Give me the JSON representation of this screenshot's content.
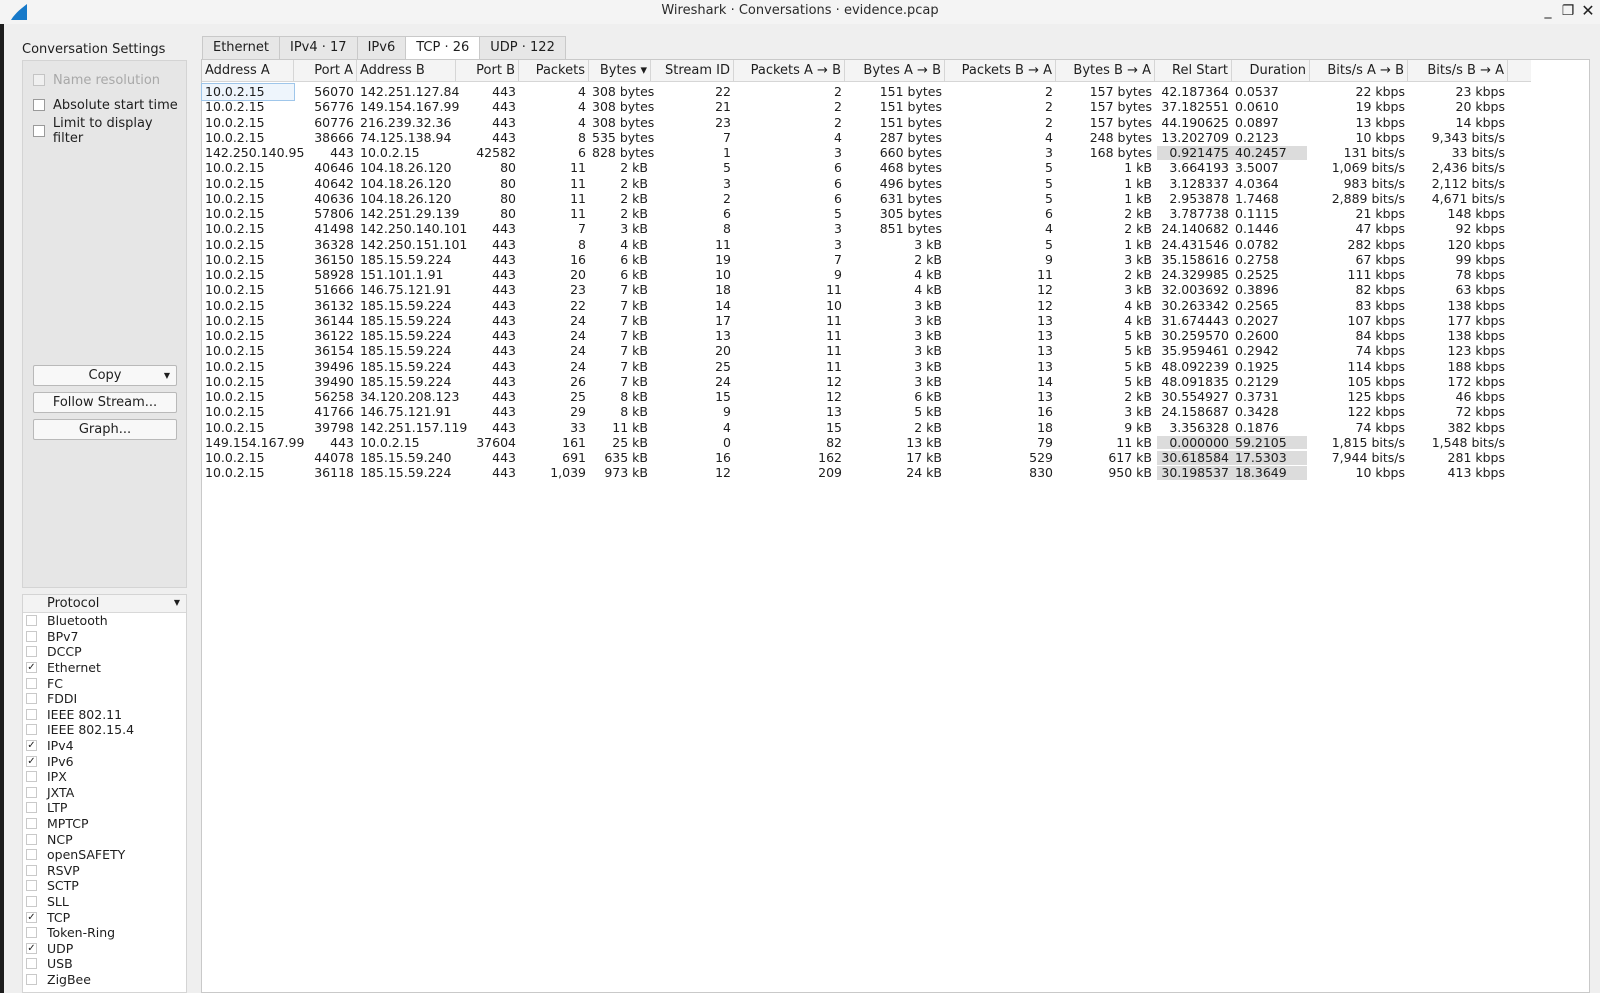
{
  "window": {
    "title": "Wireshark · Conversations · evidence.pcap",
    "min": "_",
    "max": "❐",
    "close": "✕"
  },
  "settings": {
    "title": "Conversation Settings",
    "name_resolution": "Name resolution",
    "absolute_start": "Absolute start time",
    "limit_filter": "Limit to display filter",
    "copy": "Copy",
    "follow": "Follow Stream...",
    "graph": "Graph..."
  },
  "protocols": {
    "header": "Protocol",
    "items": [
      {
        "name": "Bluetooth",
        "checked": false
      },
      {
        "name": "BPv7",
        "checked": false
      },
      {
        "name": "DCCP",
        "checked": false
      },
      {
        "name": "Ethernet",
        "checked": true
      },
      {
        "name": "FC",
        "checked": false
      },
      {
        "name": "FDDI",
        "checked": false
      },
      {
        "name": "IEEE 802.11",
        "checked": false
      },
      {
        "name": "IEEE 802.15.4",
        "checked": false
      },
      {
        "name": "IPv4",
        "checked": true
      },
      {
        "name": "IPv6",
        "checked": true
      },
      {
        "name": "IPX",
        "checked": false
      },
      {
        "name": "JXTA",
        "checked": false
      },
      {
        "name": "LTP",
        "checked": false
      },
      {
        "name": "MPTCP",
        "checked": false
      },
      {
        "name": "NCP",
        "checked": false
      },
      {
        "name": "openSAFETY",
        "checked": false
      },
      {
        "name": "RSVP",
        "checked": false
      },
      {
        "name": "SCTP",
        "checked": false
      },
      {
        "name": "SLL",
        "checked": false
      },
      {
        "name": "TCP",
        "checked": true
      },
      {
        "name": "Token-Ring",
        "checked": false
      },
      {
        "name": "UDP",
        "checked": true
      },
      {
        "name": "USB",
        "checked": false
      },
      {
        "name": "ZigBee",
        "checked": false
      }
    ]
  },
  "tabs": [
    {
      "label": "Ethernet",
      "active": false
    },
    {
      "label": "IPv4 · 17",
      "active": false
    },
    {
      "label": "IPv6",
      "active": false
    },
    {
      "label": "TCP · 26",
      "active": true
    },
    {
      "label": "UDP · 122",
      "active": false
    }
  ],
  "columns": [
    "Address A",
    "Port A",
    "Address B",
    "Port B",
    "Packets",
    "Bytes ▾",
    "Stream ID",
    "Packets A → B",
    "Bytes A → B",
    "Packets B → A",
    "Bytes B → A",
    "Rel Start",
    "Duration",
    "Bits/s A → B",
    "Bits/s B → A"
  ],
  "rows": [
    [
      "10.0.2.15",
      "56070",
      "142.251.127.84",
      "443",
      "4",
      "308 bytes",
      "22",
      "2",
      "151 bytes",
      "2",
      "157 bytes",
      "42.187364",
      "0.0537",
      "22 kbps",
      "23 kbps"
    ],
    [
      "10.0.2.15",
      "56776",
      "149.154.167.99",
      "443",
      "4",
      "308 bytes",
      "21",
      "2",
      "151 bytes",
      "2",
      "157 bytes",
      "37.182551",
      "0.0610",
      "19 kbps",
      "20 kbps"
    ],
    [
      "10.0.2.15",
      "60776",
      "216.239.32.36",
      "443",
      "4",
      "308 bytes",
      "23",
      "2",
      "151 bytes",
      "2",
      "157 bytes",
      "44.190625",
      "0.0897",
      "13 kbps",
      "14 kbps"
    ],
    [
      "10.0.2.15",
      "38666",
      "74.125.138.94",
      "443",
      "8",
      "535 bytes",
      "7",
      "4",
      "287 bytes",
      "4",
      "248 bytes",
      "13.202709",
      "0.2123",
      "10 kbps",
      "9,343 bits/s"
    ],
    [
      "142.250.140.95",
      "443",
      "10.0.2.15",
      "42582",
      "6",
      "828 bytes",
      "1",
      "3",
      "660 bytes",
      "3",
      "168 bytes",
      "0.921475",
      "40.2457",
      "131 bits/s",
      "33 bits/s"
    ],
    [
      "10.0.2.15",
      "40646",
      "104.18.26.120",
      "80",
      "11",
      "2 kB",
      "5",
      "6",
      "468 bytes",
      "5",
      "1 kB",
      "3.664193",
      "3.5007",
      "1,069 bits/s",
      "2,436 bits/s"
    ],
    [
      "10.0.2.15",
      "40642",
      "104.18.26.120",
      "80",
      "11",
      "2 kB",
      "3",
      "6",
      "496 bytes",
      "5",
      "1 kB",
      "3.128337",
      "4.0364",
      "983 bits/s",
      "2,112 bits/s"
    ],
    [
      "10.0.2.15",
      "40636",
      "104.18.26.120",
      "80",
      "11",
      "2 kB",
      "2",
      "6",
      "631 bytes",
      "5",
      "1 kB",
      "2.953878",
      "1.7468",
      "2,889 bits/s",
      "4,671 bits/s"
    ],
    [
      "10.0.2.15",
      "57806",
      "142.251.29.139",
      "80",
      "11",
      "2 kB",
      "6",
      "5",
      "305 bytes",
      "6",
      "2 kB",
      "3.787738",
      "0.1115",
      "21 kbps",
      "148 kbps"
    ],
    [
      "10.0.2.15",
      "41498",
      "142.250.140.101",
      "443",
      "7",
      "3 kB",
      "8",
      "3",
      "851 bytes",
      "4",
      "2 kB",
      "24.140682",
      "0.1446",
      "47 kbps",
      "92 kbps"
    ],
    [
      "10.0.2.15",
      "36328",
      "142.250.151.101",
      "443",
      "8",
      "4 kB",
      "11",
      "3",
      "3 kB",
      "5",
      "1 kB",
      "24.431546",
      "0.0782",
      "282 kbps",
      "120 kbps"
    ],
    [
      "10.0.2.15",
      "36150",
      "185.15.59.224",
      "443",
      "16",
      "6 kB",
      "19",
      "7",
      "2 kB",
      "9",
      "3 kB",
      "35.158616",
      "0.2758",
      "67 kbps",
      "99 kbps"
    ],
    [
      "10.0.2.15",
      "58928",
      "151.101.1.91",
      "443",
      "20",
      "6 kB",
      "10",
      "9",
      "4 kB",
      "11",
      "2 kB",
      "24.329985",
      "0.2525",
      "111 kbps",
      "78 kbps"
    ],
    [
      "10.0.2.15",
      "51666",
      "146.75.121.91",
      "443",
      "23",
      "7 kB",
      "18",
      "11",
      "4 kB",
      "12",
      "3 kB",
      "32.003692",
      "0.3896",
      "82 kbps",
      "63 kbps"
    ],
    [
      "10.0.2.15",
      "36132",
      "185.15.59.224",
      "443",
      "22",
      "7 kB",
      "14",
      "10",
      "3 kB",
      "12",
      "4 kB",
      "30.263342",
      "0.2565",
      "83 kbps",
      "138 kbps"
    ],
    [
      "10.0.2.15",
      "36144",
      "185.15.59.224",
      "443",
      "24",
      "7 kB",
      "17",
      "11",
      "3 kB",
      "13",
      "4 kB",
      "31.674443",
      "0.2027",
      "107 kbps",
      "177 kbps"
    ],
    [
      "10.0.2.15",
      "36122",
      "185.15.59.224",
      "443",
      "24",
      "7 kB",
      "13",
      "11",
      "3 kB",
      "13",
      "5 kB",
      "30.259570",
      "0.2600",
      "84 kbps",
      "138 kbps"
    ],
    [
      "10.0.2.15",
      "36154",
      "185.15.59.224",
      "443",
      "24",
      "7 kB",
      "20",
      "11",
      "3 kB",
      "13",
      "5 kB",
      "35.959461",
      "0.2942",
      "74 kbps",
      "123 kbps"
    ],
    [
      "10.0.2.15",
      "39496",
      "185.15.59.224",
      "443",
      "24",
      "7 kB",
      "25",
      "11",
      "3 kB",
      "13",
      "5 kB",
      "48.092239",
      "0.1925",
      "114 kbps",
      "188 kbps"
    ],
    [
      "10.0.2.15",
      "39490",
      "185.15.59.224",
      "443",
      "26",
      "7 kB",
      "24",
      "12",
      "3 kB",
      "14",
      "5 kB",
      "48.091835",
      "0.2129",
      "105 kbps",
      "172 kbps"
    ],
    [
      "10.0.2.15",
      "56258",
      "34.120.208.123",
      "443",
      "25",
      "8 kB",
      "15",
      "12",
      "6 kB",
      "13",
      "2 kB",
      "30.554927",
      "0.3731",
      "125 kbps",
      "46 kbps"
    ],
    [
      "10.0.2.15",
      "41766",
      "146.75.121.91",
      "443",
      "29",
      "8 kB",
      "9",
      "13",
      "5 kB",
      "16",
      "3 kB",
      "24.158687",
      "0.3428",
      "122 kbps",
      "72 kbps"
    ],
    [
      "10.0.2.15",
      "39798",
      "142.251.157.119",
      "443",
      "33",
      "11 kB",
      "4",
      "15",
      "2 kB",
      "18",
      "9 kB",
      "3.356328",
      "0.1876",
      "74 kbps",
      "382 kbps"
    ],
    [
      "149.154.167.99",
      "443",
      "10.0.2.15",
      "37604",
      "161",
      "25 kB",
      "0",
      "82",
      "13 kB",
      "79",
      "11 kB",
      "0.000000",
      "59.2105",
      "1,815 bits/s",
      "1,548 bits/s"
    ],
    [
      "10.0.2.15",
      "44078",
      "185.15.59.240",
      "443",
      "691",
      "635 kB",
      "16",
      "162",
      "17 kB",
      "529",
      "617 kB",
      "30.618584",
      "17.5303",
      "7,944 bits/s",
      "281 kbps"
    ],
    [
      "10.0.2.15",
      "36118",
      "185.15.59.224",
      "443",
      "1,039",
      "973 kB",
      "12",
      "209",
      "24 kB",
      "830",
      "950 kB",
      "30.198537",
      "18.3649",
      "10 kbps",
      "413 kbps"
    ]
  ]
}
